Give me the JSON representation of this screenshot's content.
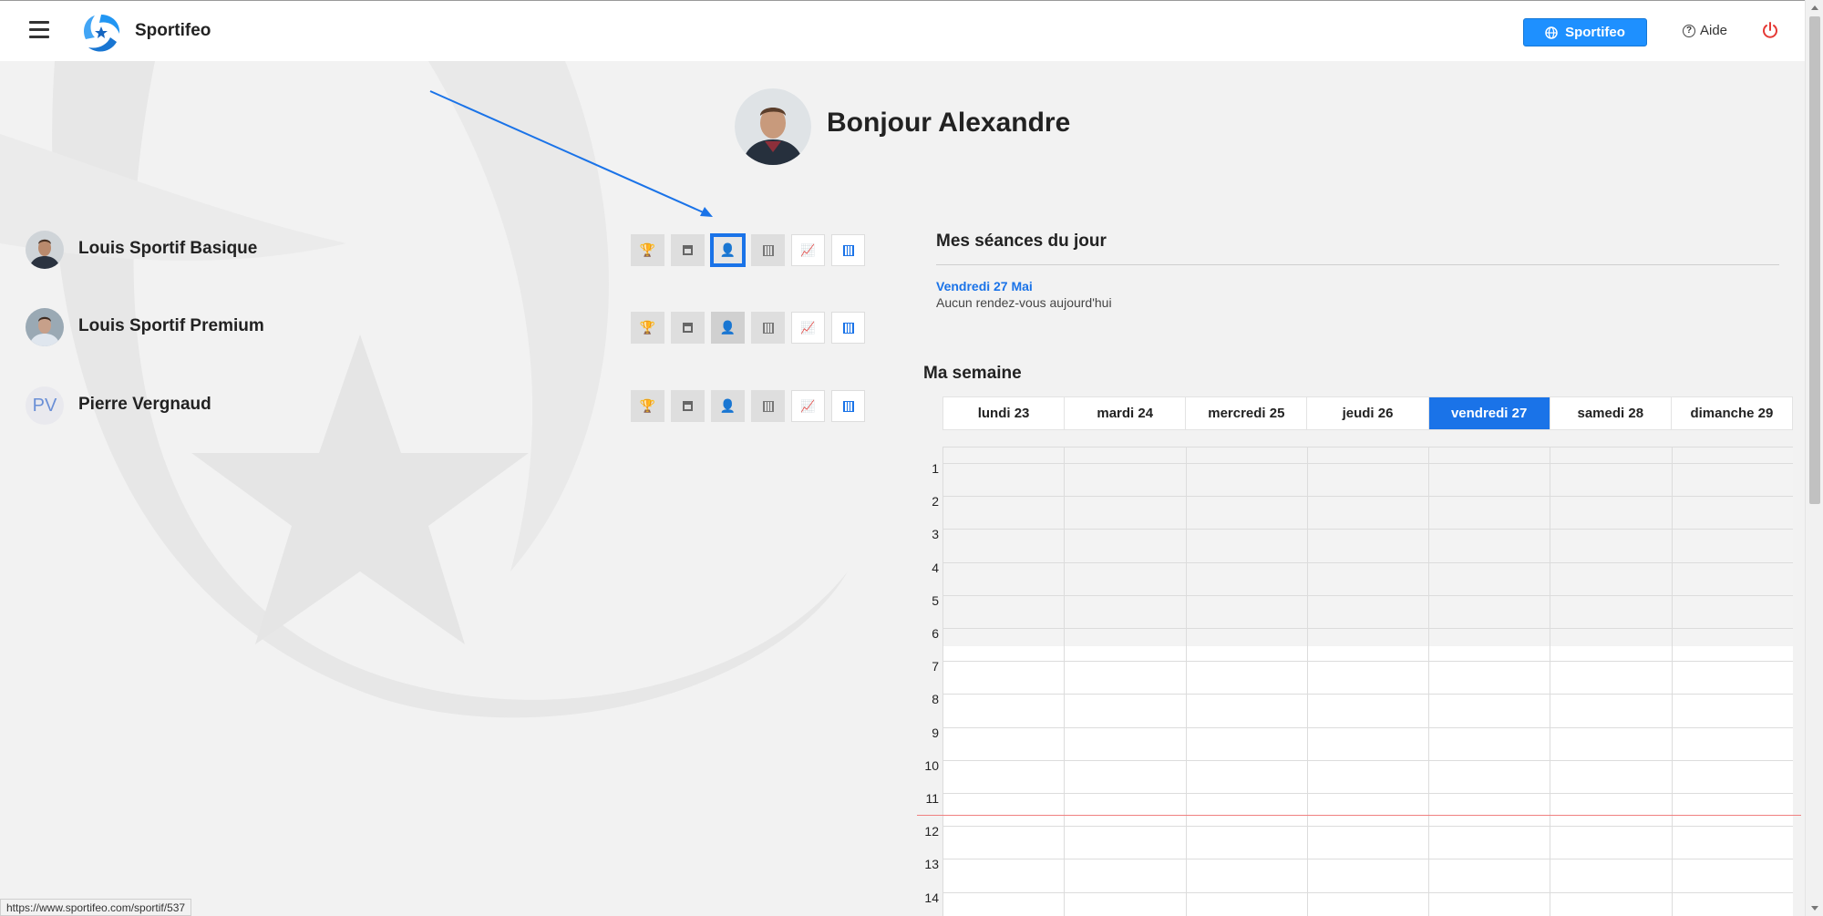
{
  "header": {
    "brand": "Sportifeo",
    "primary_button": "Sportifeo",
    "help": "Aide"
  },
  "greeting": "Bonjour Alexandre",
  "athletes": [
    {
      "name": "Louis Sportif Basique",
      "avatar": "photo"
    },
    {
      "name": "Louis Sportif Premium",
      "avatar": "photo"
    },
    {
      "name": "Pierre Vergnaud",
      "initials": "PV"
    }
  ],
  "action_icons": [
    "trophy-icon",
    "calendar-icon",
    "user-icon",
    "calendar-grid-icon",
    "chart-line-icon",
    "calendar-blue-icon"
  ],
  "seances": {
    "title": "Mes séances du jour",
    "date": "Vendredi 27 Mai",
    "empty": "Aucun rendez-vous aujourd'hui"
  },
  "semaine": {
    "title": "Ma semaine",
    "days": [
      "lundi 23",
      "mardi 24",
      "mercredi 25",
      "jeudi 26",
      "vendredi 27",
      "samedi 28",
      "dimanche 29"
    ],
    "active_day": "vendredi 27",
    "hours": [
      "1",
      "2",
      "3",
      "4",
      "5",
      "6",
      "7",
      "8",
      "9",
      "10",
      "11",
      "12",
      "13",
      "14"
    ]
  },
  "status_url": "https://www.sportifeo.com/sportif/537",
  "colors": {
    "accent": "#1a73e8",
    "button": "#1e90ff",
    "power": "#e53935",
    "now_line": "#f08080"
  }
}
